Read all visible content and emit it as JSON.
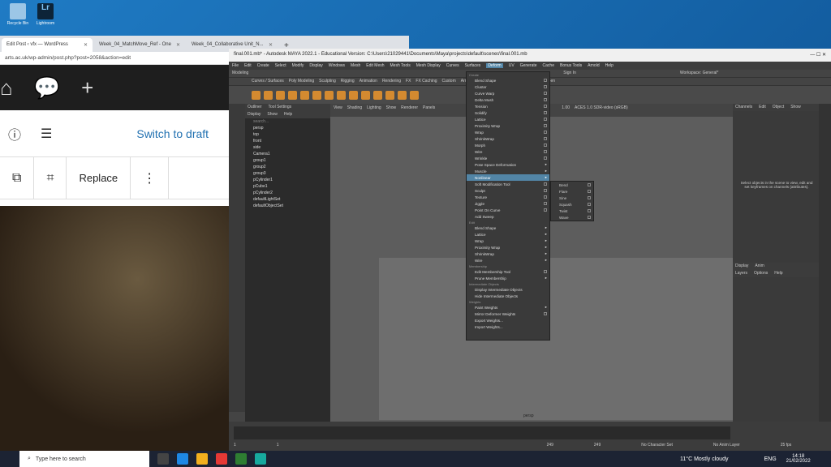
{
  "desktop": {
    "icons": [
      {
        "label": "Recycle Bin"
      },
      {
        "label": "Lightroom"
      }
    ]
  },
  "browser": {
    "tabs": [
      {
        "label": "Edit Post ‹ vfx — WordPress"
      },
      {
        "label": "Week_04_MatchMove_Ref - One"
      },
      {
        "label": "Week_04_Collaborative Unit_N..."
      }
    ],
    "new_tab": "+",
    "address": "arts.ac.uk/wp-admin/post.php?post=2058&action=edit",
    "switch_draft": "Switch to draft",
    "publish_partial": "Pr",
    "replace": "Replace",
    "more": "⋮"
  },
  "maya": {
    "title": "final.001.mb* - Autodesk MAYA 2022.1 - Educational Version: C:\\Users\\21029441\\Documents\\Maya\\projects\\default\\scenes\\final.001.mb",
    "menus": [
      "File",
      "Edit",
      "Create",
      "Select",
      "Modify",
      "Display",
      "Windows",
      "Mesh",
      "Edit Mesh",
      "Mesh Tools",
      "Mesh Display",
      "Curves",
      "Surfaces",
      "Deform",
      "UV",
      "Generate",
      "Cache",
      "Bonus Tools",
      "Arnold",
      "Help"
    ],
    "workspace": "Workspace: General*",
    "mode": "Modeling",
    "signin": "Sign In",
    "shelf_tabs": [
      "Curves / Surfaces",
      "Poly Modeling",
      "Sculpting",
      "Rigging",
      "Animation",
      "Rendering",
      "FX",
      "FX Caching",
      "Custom",
      "Arnold",
      "Bifrost",
      "MASH",
      "Motion Graphics",
      "XGen"
    ],
    "outliner": {
      "tabs": [
        "Outliner",
        "Tool Settings"
      ],
      "menu": [
        "Display",
        "Show",
        "Help"
      ],
      "search": "search...",
      "items": [
        "persp",
        "top",
        "front",
        "side",
        "Camera1",
        "group1",
        "group2",
        "group3",
        "pCylinder1",
        "pCube1",
        "pCylinder2",
        "defaultLightSet",
        "defaultObjectSet"
      ]
    },
    "viewport": {
      "menu": [
        "View",
        "Shading",
        "Lighting",
        "Show",
        "Renderer",
        "Panels"
      ],
      "gamma": "1.00",
      "colorspace": "ACES 1.0 SDR-video (sRGB)",
      "cam": "persp"
    },
    "deform_menu": [
      {
        "t": "sec",
        "label": "Create"
      },
      {
        "label": "Blend Shape",
        "box": true
      },
      {
        "label": "Cluster",
        "box": true
      },
      {
        "label": "Curve Warp",
        "box": true
      },
      {
        "label": "Delta Mush",
        "box": true
      },
      {
        "label": "Tension",
        "box": true
      },
      {
        "label": "Solidify",
        "box": true
      },
      {
        "label": "Lattice",
        "box": true
      },
      {
        "label": "Proximity Wrap",
        "box": true
      },
      {
        "label": "Wrap",
        "box": true
      },
      {
        "label": "ShrinkWrap",
        "box": true
      },
      {
        "label": "Morph",
        "box": true
      },
      {
        "label": "Wire",
        "box": true
      },
      {
        "label": "Wrinkle",
        "box": true
      },
      {
        "label": "Pose Space Deformation",
        "arr": true
      },
      {
        "label": "Muscle",
        "arr": true
      },
      {
        "label": "Nonlinear",
        "arr": true,
        "hi": true
      },
      {
        "label": "Soft Modification Tool",
        "box": true
      },
      {
        "label": "Sculpt",
        "box": true
      },
      {
        "label": "Texture",
        "box": true
      },
      {
        "label": "Jiggle",
        "box": true
      },
      {
        "label": "Point On Curve",
        "box": true
      },
      {
        "label": "Add Sweep"
      },
      {
        "t": "sec",
        "label": "Edit"
      },
      {
        "label": "Blend Shape",
        "arr": true
      },
      {
        "label": "Lattice",
        "arr": true
      },
      {
        "label": "Wrap",
        "arr": true
      },
      {
        "label": "Proximity Wrap",
        "arr": true
      },
      {
        "label": "ShrinkWrap",
        "arr": true
      },
      {
        "label": "Wire",
        "arr": true
      },
      {
        "t": "sec",
        "label": "Membership"
      },
      {
        "label": "Edit Membership Tool",
        "box": true
      },
      {
        "label": "Prune Membership",
        "arr": true
      },
      {
        "t": "sec",
        "label": "Intermediate Objects"
      },
      {
        "label": "Display Intermediate Objects"
      },
      {
        "label": "Hide Intermediate Objects"
      },
      {
        "t": "sec",
        "label": "Weights"
      },
      {
        "label": "Paint Weights",
        "arr": true
      },
      {
        "label": "Mirror Deformer Weights",
        "box": true
      },
      {
        "label": "Export Weights..."
      },
      {
        "label": "Import Weights..."
      }
    ],
    "nonlinear_sub": [
      "Bend",
      "Flare",
      "Sine",
      "Squash",
      "Twist",
      "Wave"
    ],
    "channel_box": {
      "menu": [
        "Channels",
        "Edit",
        "Object",
        "Show"
      ],
      "msg": "Select objects in the scene to view, edit and set keyframes on channels (attributes)."
    },
    "layer": {
      "tabs": [
        "Display",
        "Anim"
      ],
      "menu": [
        "Layers",
        "Options",
        "Help"
      ]
    },
    "time": {
      "start": "1",
      "end": "249",
      "end2": "249",
      "cur": "1",
      "charset": "No Character Set",
      "anim_layer": "No Anim Layer",
      "fps": "25 fps"
    }
  },
  "taskbar": {
    "search": "Type here to search",
    "weather": "11°C  Mostly cloudy",
    "lang": "ENG",
    "time": "14:18",
    "date": "21/02/2022"
  }
}
